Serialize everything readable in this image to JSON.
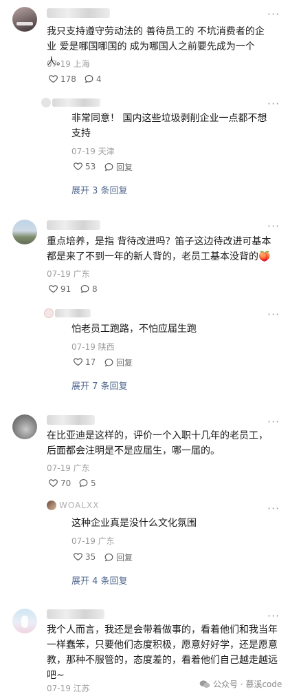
{
  "comments": [
    {
      "text": "我只支持遵守劳动法的 善待员工的 不坑消费者的企业 爱是哪国哪国的 成为哪国人之前要先成为一个人。",
      "meta": "07-19 上海",
      "likes": "178",
      "replies": "4",
      "reply": {
        "text": "非常同意！ 国内这些垃圾剥削企业一点都不想支持",
        "meta": "07-19 天津",
        "likes": "53",
        "reply_label": "回复"
      },
      "expand": "展开 3 条回复"
    },
    {
      "text": "重点培养，是指 背待改进吗？笛子这边待改进可基本都是来了不到一年的新人背的，老员工基本没背的🍑",
      "meta": "07-19 广东",
      "likes": "91",
      "replies": "8",
      "reply": {
        "text": "怕老员工跑路，不怕应届生跑",
        "meta": "07-19 陕西",
        "likes": "17",
        "reply_label": "回复"
      },
      "expand": "展开 7 条回复"
    },
    {
      "text": "在比亚迪是这样的，评价一个入职十几年的老员工，后面都会注明是不是应届生，哪一届的。",
      "meta": "07-19 广东",
      "likes": "70",
      "replies": "5",
      "reply": {
        "name": "WOALXX",
        "text": "这种企业真是没什么文化氛围",
        "meta": "07-19 广东",
        "likes": "35",
        "reply_label": "回复"
      },
      "expand": "展开 4 条回复"
    },
    {
      "text": "我个人而言，我还是会带着做事的，看着他们和我当年一样蠢笨，只要他们态度积极，愿意好好学，还是愿意教，那种不服管的，态度差的，看着他们自己越走越远吧~",
      "meta": "07-19 江苏"
    }
  ],
  "watermark": "公众号 · 慕溪code"
}
